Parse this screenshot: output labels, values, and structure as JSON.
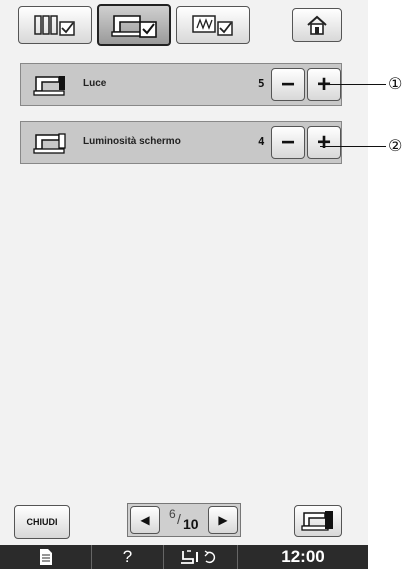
{
  "tabs": [
    {
      "name": "sewing-settings",
      "active": false
    },
    {
      "name": "general-settings",
      "active": true
    },
    {
      "name": "embroidery-settings",
      "active": false
    }
  ],
  "settings": [
    {
      "label": "Luce",
      "value": "5",
      "callout": "①"
    },
    {
      "label": "Luminosità schermo",
      "value": "4",
      "callout": "②"
    }
  ],
  "pagination": {
    "current": "6",
    "total": "10"
  },
  "buttons": {
    "close_label": "CHIUDI",
    "minus": "−",
    "plus": "+"
  },
  "statusbar": {
    "help": "?",
    "time": "12:00"
  }
}
